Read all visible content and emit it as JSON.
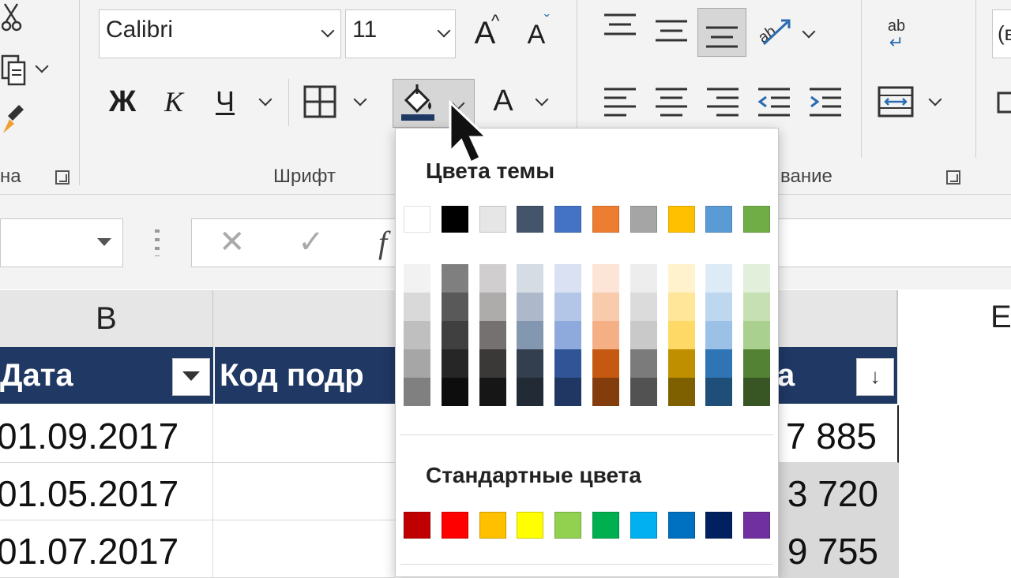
{
  "ribbon": {
    "font_name": "Calibri",
    "font_size": "11",
    "bold_label": "Ж",
    "italic_label": "К",
    "underline_label": "Ч",
    "font_color_letter": "A",
    "grow_font_letter": "A",
    "shrink_font_letter": "A",
    "wrap_icon_text": "ab",
    "clipboard_group_label": "на",
    "font_group_label": "Шрифт",
    "alignment_group_label": "вание",
    "right_edge_text": "(в"
  },
  "formula_bar": {
    "cancel": "✕",
    "enter": "✓",
    "fx": "f"
  },
  "sheet": {
    "columns": [
      {
        "label": "B"
      },
      {
        "label": ""
      },
      {
        "label": "E"
      }
    ],
    "headers": {
      "date": "Дата",
      "code": "Код подр",
      "amount": "а",
      "sort_glyph": "↓"
    },
    "rows": [
      {
        "date": "01.09.2017",
        "amount": "7 885"
      },
      {
        "date": "01.05.2017",
        "amount": "3 720"
      },
      {
        "date": "01.07.2017",
        "amount": "9 755"
      }
    ]
  },
  "palette": {
    "theme_title": "Цвета темы",
    "standard_title": "Стандартные цвета",
    "theme_colors": [
      {
        "name": "white",
        "hex": "#ffffff",
        "shades": [
          "#f2f2f2",
          "#d9d9d9",
          "#bfbfbf",
          "#a6a6a6",
          "#808080"
        ]
      },
      {
        "name": "black",
        "hex": "#000000",
        "shades": [
          "#7f7f7f",
          "#595959",
          "#404040",
          "#262626",
          "#0d0d0d"
        ]
      },
      {
        "name": "light-gray",
        "hex": "#e7e6e6",
        "shades": [
          "#d0cece",
          "#aeabab",
          "#757171",
          "#3b3838",
          "#171616"
        ]
      },
      {
        "name": "dark-blue",
        "hex": "#44546a",
        "shades": [
          "#d6dce4",
          "#adb9ca",
          "#8497b0",
          "#333f4f",
          "#222a35"
        ]
      },
      {
        "name": "blue",
        "hex": "#4472c4",
        "shades": [
          "#d9e1f2",
          "#b4c6e7",
          "#8ea9db",
          "#305496",
          "#203764"
        ]
      },
      {
        "name": "orange",
        "hex": "#ed7d31",
        "shades": [
          "#fce4d6",
          "#f8cbad",
          "#f4b084",
          "#c65911",
          "#833c0c"
        ]
      },
      {
        "name": "gray",
        "hex": "#a5a5a5",
        "shades": [
          "#ededed",
          "#dbdbdb",
          "#c9c9c9",
          "#7b7b7b",
          "#525252"
        ]
      },
      {
        "name": "gold",
        "hex": "#ffc000",
        "shades": [
          "#fff2cc",
          "#ffe699",
          "#ffd966",
          "#bf8f00",
          "#7f6000"
        ]
      },
      {
        "name": "light-blue",
        "hex": "#5b9bd5",
        "shades": [
          "#ddebf7",
          "#bdd7ee",
          "#9bc2e6",
          "#2f75b5",
          "#1f4e78"
        ]
      },
      {
        "name": "green",
        "hex": "#70ad47",
        "shades": [
          "#e2efda",
          "#c6e0b4",
          "#a9d08e",
          "#548235",
          "#375623"
        ]
      }
    ],
    "standard_colors": [
      {
        "name": "dark-red",
        "hex": "#c00000"
      },
      {
        "name": "red",
        "hex": "#ff0000"
      },
      {
        "name": "orange",
        "hex": "#ffc000"
      },
      {
        "name": "yellow",
        "hex": "#ffff00"
      },
      {
        "name": "light-green",
        "hex": "#92d050"
      },
      {
        "name": "green",
        "hex": "#00b050"
      },
      {
        "name": "light-blue",
        "hex": "#00b0f0"
      },
      {
        "name": "blue",
        "hex": "#0070c0"
      },
      {
        "name": "dark-blue",
        "hex": "#002060"
      },
      {
        "name": "purple",
        "hex": "#7030a0"
      }
    ]
  },
  "colors": {
    "ribbon_bg": "#f3f3f3",
    "table_header": "#1f3864",
    "fill_color_bar": "#1f3864"
  }
}
